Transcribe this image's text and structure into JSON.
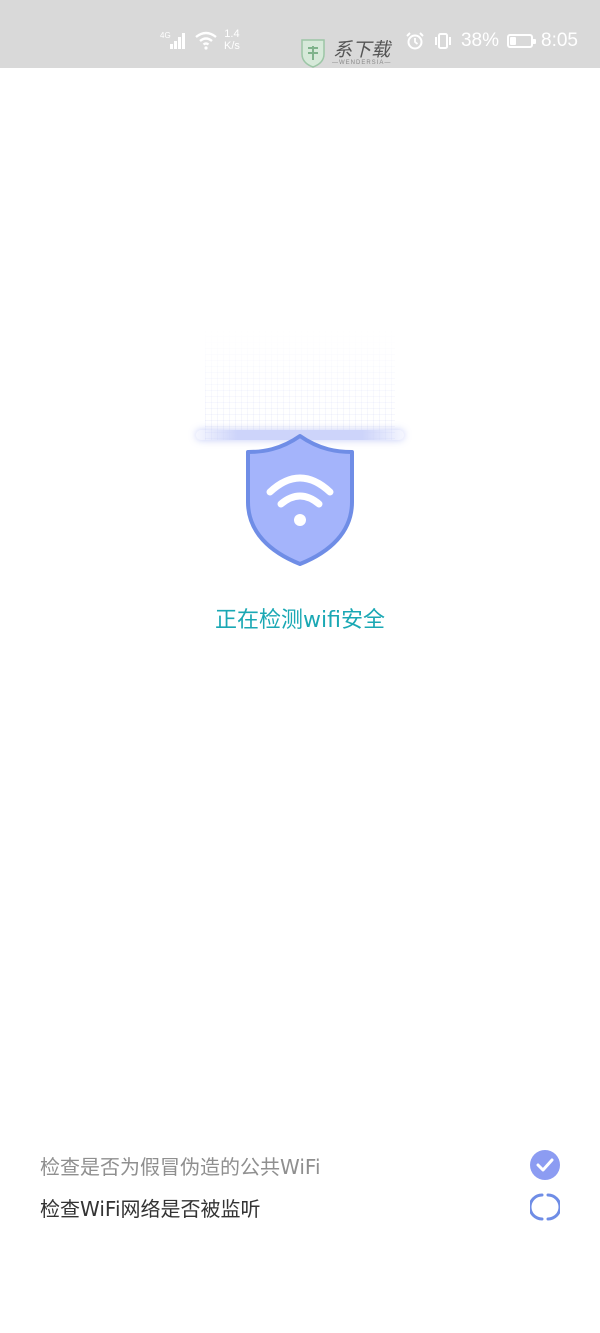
{
  "status_bar": {
    "network_type": "4G",
    "speed_value": "1.4",
    "speed_unit": "K/s",
    "battery_percent": "38%",
    "battery_level": 0.38,
    "time": "8:05",
    "watermark_main": "系下载",
    "watermark_sub": "—WENDERSIA—"
  },
  "scan": {
    "title": "正在检测wifi安全"
  },
  "checks": [
    {
      "label": "检查是否为假冒伪造的公共WiFi",
      "state": "done"
    },
    {
      "label": "检查WiFi网络是否被监听",
      "state": "in_progress"
    }
  ],
  "colors": {
    "accent_teal": "#1aa8b4",
    "shield_fill": "#a4b4fb",
    "shield_border": "#6f8de6",
    "check_done": "#8c9cf2",
    "status_bar_bg": "#d9d9d9"
  },
  "icons": {
    "shield": "shield-wifi-icon",
    "done": "check-circle-icon",
    "loading": "spinner-icon"
  }
}
